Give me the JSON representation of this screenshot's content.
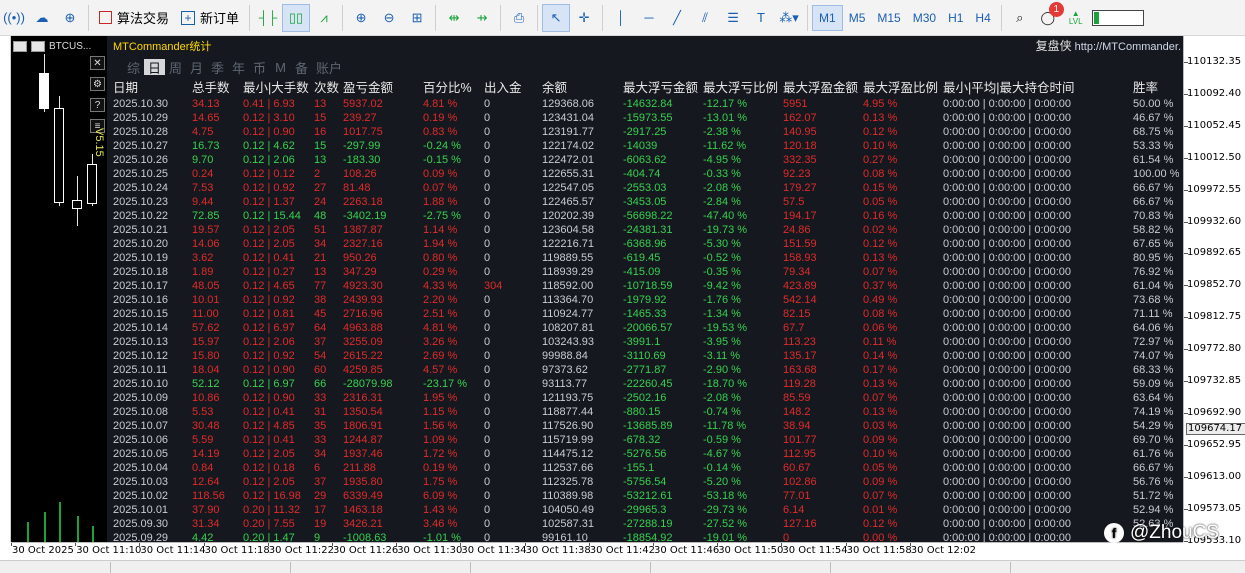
{
  "toolbar": {
    "algo_label": "算法交易",
    "new_order_label": "新订单",
    "timeframes": [
      "M1",
      "M5",
      "M15",
      "M30",
      "H1",
      "H4"
    ],
    "active_timeframe": "M1",
    "notification_count": "1",
    "level_label": "LVL",
    "level_fraction": 0.1
  },
  "chart": {
    "symbol": "BTCUS...",
    "version_label": "V5.15"
  },
  "panel": {
    "title": "MTCommander统计",
    "link_cn": "复盘侠",
    "link_url": "http://MTCommander.",
    "tabs": [
      "综",
      "日",
      "周",
      "月",
      "季",
      "年",
      "币",
      "M",
      "备",
      "账户"
    ],
    "active_tab": 1,
    "headers": [
      "日期",
      "总手数",
      "最小|大手数",
      "次数",
      "盈亏金额",
      "百分比%",
      "出入金",
      "余额",
      "最大浮亏金额",
      "最大浮亏比例",
      "最大浮盈金额",
      "最大浮盈比例",
      "最小|平均|最大持仓时间",
      "胜率"
    ],
    "rows": [
      {
        "date": "2025.10.30",
        "tot": "34.13",
        "mm": "0.41 | 6.93",
        "cnt": "13",
        "pnl": "5937.02",
        "pct": "4.81 %",
        "dep": "0",
        "bal": "129368.06",
        "mfl": "-14632.84",
        "mflp": "-12.17 %",
        "mfp": "5951",
        "mfpp": "4.95 %",
        "time": "0:00:00 | 0:00:00 | 0:00:00",
        "win": "50.00 %",
        "c": "red"
      },
      {
        "date": "2025.10.29",
        "tot": "14.65",
        "mm": "0.12 | 3.10",
        "cnt": "15",
        "pnl": "239.27",
        "pct": "0.19 %",
        "dep": "0",
        "bal": "123431.04",
        "mfl": "-15973.55",
        "mflp": "-13.01 %",
        "mfp": "162.07",
        "mfpp": "0.13 %",
        "time": "0:00:00 | 0:00:00 | 0:00:00",
        "win": "46.67 %",
        "c": "red"
      },
      {
        "date": "2025.10.28",
        "tot": "4.75",
        "mm": "0.12 | 0.90",
        "cnt": "16",
        "pnl": "1017.75",
        "pct": "0.83 %",
        "dep": "0",
        "bal": "123191.77",
        "mfl": "-2917.25",
        "mflp": "-2.38 %",
        "mfp": "140.95",
        "mfpp": "0.12 %",
        "time": "0:00:00 | 0:00:00 | 0:00:00",
        "win": "68.75 %",
        "c": "red"
      },
      {
        "date": "2025.10.27",
        "tot": "16.73",
        "mm": "0.12 | 4.62",
        "cnt": "15",
        "pnl": "-297.99",
        "pct": "-0.24 %",
        "dep": "0",
        "bal": "122174.02",
        "mfl": "-14039",
        "mflp": "-11.62 %",
        "mfp": "120.18",
        "mfpp": "0.10 %",
        "time": "0:00:00 | 0:00:00 | 0:00:00",
        "win": "53.33 %",
        "c": "green"
      },
      {
        "date": "2025.10.26",
        "tot": "9.70",
        "mm": "0.12 | 2.06",
        "cnt": "13",
        "pnl": "-183.30",
        "pct": "-0.15 %",
        "dep": "0",
        "bal": "122472.01",
        "mfl": "-6063.62",
        "mflp": "-4.95 %",
        "mfp": "332.35",
        "mfpp": "0.27 %",
        "time": "0:00:00 | 0:00:00 | 0:00:00",
        "win": "61.54 %",
        "c": "green"
      },
      {
        "date": "2025.10.25",
        "tot": "0.24",
        "mm": "0.12 | 0.12",
        "cnt": "2",
        "pnl": "108.26",
        "pct": "0.09 %",
        "dep": "0",
        "bal": "122655.31",
        "mfl": "-404.74",
        "mflp": "-0.33 %",
        "mfp": "92.23",
        "mfpp": "0.08 %",
        "time": "0:00:00 | 0:00:00 | 0:00:00",
        "win": "100.00 %",
        "c": "red"
      },
      {
        "date": "2025.10.24",
        "tot": "7.53",
        "mm": "0.12 | 0.92",
        "cnt": "27",
        "pnl": "81.48",
        "pct": "0.07 %",
        "dep": "0",
        "bal": "122547.05",
        "mfl": "-2553.03",
        "mflp": "-2.08 %",
        "mfp": "179.27",
        "mfpp": "0.15 %",
        "time": "0:00:00 | 0:00:00 | 0:00:00",
        "win": "66.67 %",
        "c": "red"
      },
      {
        "date": "2025.10.23",
        "tot": "9.44",
        "mm": "0.12 | 1.37",
        "cnt": "24",
        "pnl": "2263.18",
        "pct": "1.88 %",
        "dep": "0",
        "bal": "122465.57",
        "mfl": "-3453.05",
        "mflp": "-2.84 %",
        "mfp": "57.5",
        "mfpp": "0.05 %",
        "time": "0:00:00 | 0:00:00 | 0:00:00",
        "win": "66.67 %",
        "c": "red"
      },
      {
        "date": "2025.10.22",
        "tot": "72.85",
        "mm": "0.12 | 15.44",
        "cnt": "48",
        "pnl": "-3402.19",
        "pct": "-2.75 %",
        "dep": "0",
        "bal": "120202.39",
        "mfl": "-56698.22",
        "mflp": "-47.40 %",
        "mfp": "194.17",
        "mfpp": "0.16 %",
        "time": "0:00:00 | 0:00:00 | 0:00:00",
        "win": "70.83 %",
        "c": "green"
      },
      {
        "date": "2025.10.21",
        "tot": "19.57",
        "mm": "0.12 | 2.05",
        "cnt": "51",
        "pnl": "1387.87",
        "pct": "1.14 %",
        "dep": "0",
        "bal": "123604.58",
        "mfl": "-24381.31",
        "mflp": "-19.73 %",
        "mfp": "24.86",
        "mfpp": "0.02 %",
        "time": "0:00:00 | 0:00:00 | 0:00:00",
        "win": "58.82 %",
        "c": "red"
      },
      {
        "date": "2025.10.20",
        "tot": "14.06",
        "mm": "0.12 | 2.05",
        "cnt": "34",
        "pnl": "2327.16",
        "pct": "1.94 %",
        "dep": "0",
        "bal": "122216.71",
        "mfl": "-6368.96",
        "mflp": "-5.30 %",
        "mfp": "151.59",
        "mfpp": "0.12 %",
        "time": "0:00:00 | 0:00:00 | 0:00:00",
        "win": "67.65 %",
        "c": "red"
      },
      {
        "date": "2025.10.19",
        "tot": "3.62",
        "mm": "0.12 | 0.41",
        "cnt": "21",
        "pnl": "950.26",
        "pct": "0.80 %",
        "dep": "0",
        "bal": "119889.55",
        "mfl": "-619.45",
        "mflp": "-0.52 %",
        "mfp": "158.93",
        "mfpp": "0.13 %",
        "time": "0:00:00 | 0:00:00 | 0:00:00",
        "win": "80.95 %",
        "c": "red"
      },
      {
        "date": "2025.10.18",
        "tot": "1.89",
        "mm": "0.12 | 0.27",
        "cnt": "13",
        "pnl": "347.29",
        "pct": "0.29 %",
        "dep": "0",
        "bal": "118939.29",
        "mfl": "-415.09",
        "mflp": "-0.35 %",
        "mfp": "79.34",
        "mfpp": "0.07 %",
        "time": "0:00:00 | 0:00:00 | 0:00:00",
        "win": "76.92 %",
        "c": "red"
      },
      {
        "date": "2025.10.17",
        "tot": "48.05",
        "mm": "0.12 | 4.65",
        "cnt": "77",
        "pnl": "4923.30",
        "pct": "4.33 %",
        "dep": "304",
        "bal": "118592.00",
        "mfl": "-10718.59",
        "mflp": "-9.42 %",
        "mfp": "423.89",
        "mfpp": "0.37 %",
        "time": "0:00:00 | 0:00:00 | 0:00:00",
        "win": "61.04 %",
        "c": "red",
        "depRed": true
      },
      {
        "date": "2025.10.16",
        "tot": "10.01",
        "mm": "0.12 | 0.92",
        "cnt": "38",
        "pnl": "2439.93",
        "pct": "2.20 %",
        "dep": "0",
        "bal": "113364.70",
        "mfl": "-1979.92",
        "mflp": "-1.76 %",
        "mfp": "542.14",
        "mfpp": "0.49 %",
        "time": "0:00:00 | 0:00:00 | 0:00:00",
        "win": "73.68 %",
        "c": "red"
      },
      {
        "date": "2025.10.15",
        "tot": "11.00",
        "mm": "0.12 | 0.81",
        "cnt": "45",
        "pnl": "2716.96",
        "pct": "2.51 %",
        "dep": "0",
        "bal": "110924.77",
        "mfl": "-1465.33",
        "mflp": "-1.34 %",
        "mfp": "82.15",
        "mfpp": "0.08 %",
        "time": "0:00:00 | 0:00:00 | 0:00:00",
        "win": "71.11 %",
        "c": "red"
      },
      {
        "date": "2025.10.14",
        "tot": "57.62",
        "mm": "0.12 | 6.97",
        "cnt": "64",
        "pnl": "4963.88",
        "pct": "4.81 %",
        "dep": "0",
        "bal": "108207.81",
        "mfl": "-20066.57",
        "mflp": "-19.53 %",
        "mfp": "67.7",
        "mfpp": "0.06 %",
        "time": "0:00:00 | 0:00:00 | 0:00:00",
        "win": "64.06 %",
        "c": "red"
      },
      {
        "date": "2025.10.13",
        "tot": "15.97",
        "mm": "0.12 | 2.06",
        "cnt": "37",
        "pnl": "3255.09",
        "pct": "3.26 %",
        "dep": "0",
        "bal": "103243.93",
        "mfl": "-3991.1",
        "mflp": "-3.95 %",
        "mfp": "113.23",
        "mfpp": "0.11 %",
        "time": "0:00:00 | 0:00:00 | 0:00:00",
        "win": "72.97 %",
        "c": "red"
      },
      {
        "date": "2025.10.12",
        "tot": "15.80",
        "mm": "0.12 | 0.92",
        "cnt": "54",
        "pnl": "2615.22",
        "pct": "2.69 %",
        "dep": "0",
        "bal": "99988.84",
        "mfl": "-3110.69",
        "mflp": "-3.11 %",
        "mfp": "135.17",
        "mfpp": "0.14 %",
        "time": "0:00:00 | 0:00:00 | 0:00:00",
        "win": "74.07 %",
        "c": "red"
      },
      {
        "date": "2025.10.11",
        "tot": "18.04",
        "mm": "0.12 | 0.90",
        "cnt": "60",
        "pnl": "4259.85",
        "pct": "4.57 %",
        "dep": "0",
        "bal": "97373.62",
        "mfl": "-2771.87",
        "mflp": "-2.90 %",
        "mfp": "163.68",
        "mfpp": "0.17 %",
        "time": "0:00:00 | 0:00:00 | 0:00:00",
        "win": "68.33 %",
        "c": "red"
      },
      {
        "date": "2025.10.10",
        "tot": "52.12",
        "mm": "0.12 | 6.97",
        "cnt": "66",
        "pnl": "-28079.98",
        "pct": "-23.17 %",
        "dep": "0",
        "bal": "93113.77",
        "mfl": "-22260.45",
        "mflp": "-18.70 %",
        "mfp": "119.28",
        "mfpp": "0.13 %",
        "time": "0:00:00 | 0:00:00 | 0:00:00",
        "win": "59.09 %",
        "c": "green"
      },
      {
        "date": "2025.10.09",
        "tot": "10.86",
        "mm": "0.12 | 0.90",
        "cnt": "33",
        "pnl": "2316.31",
        "pct": "1.95 %",
        "dep": "0",
        "bal": "121193.75",
        "mfl": "-2502.16",
        "mflp": "-2.08 %",
        "mfp": "85.59",
        "mfpp": "0.07 %",
        "time": "0:00:00 | 0:00:00 | 0:00:00",
        "win": "63.64 %",
        "c": "red"
      },
      {
        "date": "2025.10.08",
        "tot": "5.53",
        "mm": "0.12 | 0.41",
        "cnt": "31",
        "pnl": "1350.54",
        "pct": "1.15 %",
        "dep": "0",
        "bal": "118877.44",
        "mfl": "-880.15",
        "mflp": "-0.74 %",
        "mfp": "148.2",
        "mfpp": "0.13 %",
        "time": "0:00:00 | 0:00:00 | 0:00:00",
        "win": "74.19 %",
        "c": "red"
      },
      {
        "date": "2025.10.07",
        "tot": "30.48",
        "mm": "0.12 | 4.85",
        "cnt": "35",
        "pnl": "1806.91",
        "pct": "1.56 %",
        "dep": "0",
        "bal": "117526.90",
        "mfl": "-13685.89",
        "mflp": "-11.78 %",
        "mfp": "38.94",
        "mfpp": "0.03 %",
        "time": "0:00:00 | 0:00:00 | 0:00:00",
        "win": "54.29 %",
        "c": "red"
      },
      {
        "date": "2025.10.06",
        "tot": "5.59",
        "mm": "0.12 | 0.41",
        "cnt": "33",
        "pnl": "1244.87",
        "pct": "1.09 %",
        "dep": "0",
        "bal": "115719.99",
        "mfl": "-678.32",
        "mflp": "-0.59 %",
        "mfp": "101.77",
        "mfpp": "0.09 %",
        "time": "0:00:00 | 0:00:00 | 0:00:00",
        "win": "69.70 %",
        "c": "red"
      },
      {
        "date": "2025.10.05",
        "tot": "14.19",
        "mm": "0.12 | 2.05",
        "cnt": "34",
        "pnl": "1937.46",
        "pct": "1.72 %",
        "dep": "0",
        "bal": "114475.12",
        "mfl": "-5276.56",
        "mflp": "-4.67 %",
        "mfp": "112.95",
        "mfpp": "0.10 %",
        "time": "0:00:00 | 0:00:00 | 0:00:00",
        "win": "61.76 %",
        "c": "red"
      },
      {
        "date": "2025.10.04",
        "tot": "0.84",
        "mm": "0.12 | 0.18",
        "cnt": "6",
        "pnl": "211.88",
        "pct": "0.19 %",
        "dep": "0",
        "bal": "112537.66",
        "mfl": "-155.1",
        "mflp": "-0.14 %",
        "mfp": "60.67",
        "mfpp": "0.05 %",
        "time": "0:00:00 | 0:00:00 | 0:00:00",
        "win": "66.67 %",
        "c": "red"
      },
      {
        "date": "2025.10.03",
        "tot": "12.64",
        "mm": "0.12 | 2.05",
        "cnt": "37",
        "pnl": "1935.80",
        "pct": "1.75 %",
        "dep": "0",
        "bal": "112325.78",
        "mfl": "-5756.54",
        "mflp": "-5.20 %",
        "mfp": "102.86",
        "mfpp": "0.09 %",
        "time": "0:00:00 | 0:00:00 | 0:00:00",
        "win": "56.76 %",
        "c": "red"
      },
      {
        "date": "2025.10.02",
        "tot": "118.56",
        "mm": "0.12 | 16.98",
        "cnt": "29",
        "pnl": "6339.49",
        "pct": "6.09 %",
        "dep": "0",
        "bal": "110389.98",
        "mfl": "-53212.61",
        "mflp": "-53.18 %",
        "mfp": "77.01",
        "mfpp": "0.07 %",
        "time": "0:00:00 | 0:00:00 | 0:00:00",
        "win": "51.72 %",
        "c": "red"
      },
      {
        "date": "2025.10.01",
        "tot": "37.90",
        "mm": "0.20 | 11.32",
        "cnt": "17",
        "pnl": "1463.18",
        "pct": "1.43 %",
        "dep": "0",
        "bal": "104050.49",
        "mfl": "-29965.3",
        "mflp": "-29.73 %",
        "mfp": "6.14",
        "mfpp": "0.01 %",
        "time": "0:00:00 | 0:00:00 | 0:00:00",
        "win": "52.94 %",
        "c": "red"
      },
      {
        "date": "2025.09.30",
        "tot": "31.34",
        "mm": "0.20 | 7.55",
        "cnt": "19",
        "pnl": "3426.21",
        "pct": "3.46 %",
        "dep": "0",
        "bal": "102587.31",
        "mfl": "-27288.19",
        "mflp": "-27.52 %",
        "mfp": "127.16",
        "mfpp": "0.12 %",
        "time": "0:00:00 | 0:00:00 | 0:00:00",
        "win": "52.63 %",
        "c": "red"
      },
      {
        "date": "2025.09.29",
        "tot": "4.42",
        "mm": "0.20 | 1.47",
        "cnt": "9",
        "pnl": "-1008.63",
        "pct": "-1.01 %",
        "dep": "0",
        "bal": "99161.10",
        "mfl": "-18854.92",
        "mflp": "-19.01 %",
        "mfp": "0",
        "mfpp": "0.00 %",
        "time": "0:00:00 | 0:00:00 | 0:00:00",
        "win": "",
        "c": "green"
      }
    ]
  },
  "price_axis": {
    "labels": [
      "110132.35",
      "110092.40",
      "110052.45",
      "110012.50",
      "109972.55",
      "109932.60",
      "109892.65",
      "109852.70",
      "109812.75",
      "109772.80",
      "109732.85",
      "109692.90",
      "109652.95",
      "109613.00",
      "109573.05",
      "109533.10"
    ],
    "current_price": "109674.17"
  },
  "time_axis": {
    "labels": [
      "30 Oct 2025",
      "30 Oct 11:10",
      "30 Oct 11:14",
      "30 Oct 11:18",
      "30 Oct 11:22",
      "30 Oct 11:26",
      "30 Oct 11:30",
      "30 Oct 11:34",
      "30 Oct 11:38",
      "30 Oct 11:42",
      "30 Oct 11:46",
      "30 Oct 11:50",
      "30 Oct 11:54",
      "30 Oct 11:58",
      "30 Oct 12:02"
    ]
  },
  "watermark": {
    "text": "@ZhouCS"
  },
  "colors": {
    "profit_red": "#e02b2b",
    "loss_green": "#37d14f",
    "panel_bg": "#15181e",
    "title_yellow": "#ffd700"
  }
}
